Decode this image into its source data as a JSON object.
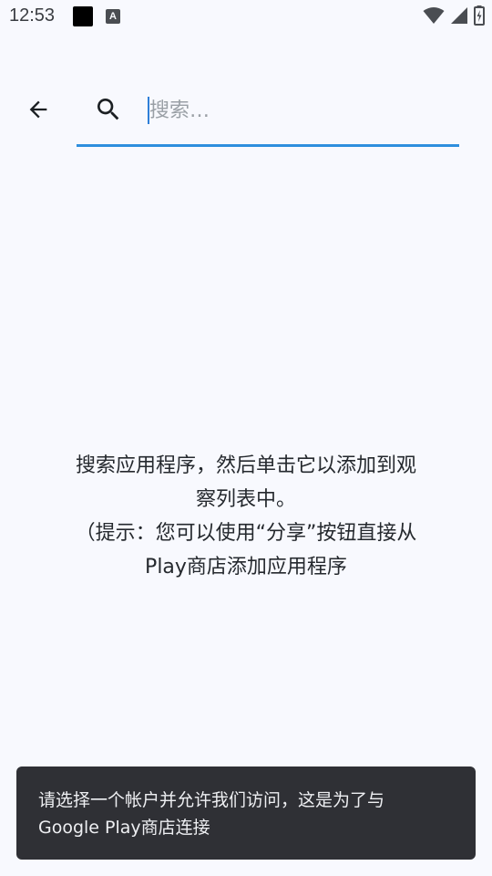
{
  "status_bar": {
    "time": "12:53",
    "a_icon_label": "A",
    "icons": [
      "notification-square-icon",
      "font-a-icon",
      "wifi-icon",
      "cellular-signal-icon",
      "battery-charging-icon"
    ]
  },
  "search": {
    "placeholder": "搜索…",
    "value": ""
  },
  "empty_state": {
    "message": "搜索应用程序，然后单击它以添加到观\n察列表中。\n（提示：您可以使用“分享”按钮直接从\nPlay商店添加应用程序"
  },
  "snackbar": {
    "text": "请选择一个帐户并允许我们访问，这是为了与\nGoogle Play商店连接"
  },
  "colors": {
    "background": "#f8f9fe",
    "accent": "#2f8fde",
    "snackbar_bg": "#2f3035"
  }
}
